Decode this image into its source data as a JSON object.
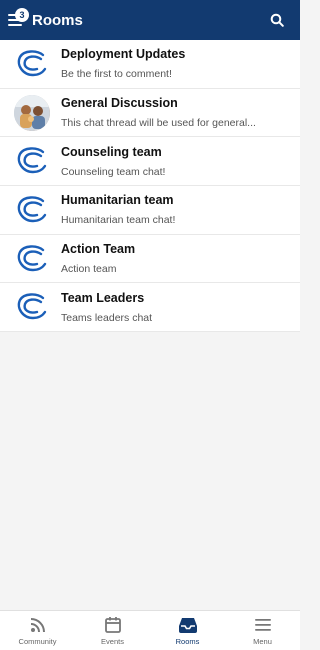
{
  "header": {
    "title": "Rooms",
    "badge_count": "3"
  },
  "rooms": [
    {
      "title": "Deployment Updates",
      "subtitle": "Be the first to comment!",
      "avatar": "logo"
    },
    {
      "title": "General Discussion",
      "subtitle": "This chat thread will be used for general...",
      "avatar": "photo"
    },
    {
      "title": "Counseling team",
      "subtitle": "Counseling team chat!",
      "avatar": "logo"
    },
    {
      "title": "Humanitarian team",
      "subtitle": "Humanitarian team chat!",
      "avatar": "logo"
    },
    {
      "title": "Action Team",
      "subtitle": "Action team",
      "avatar": "logo"
    },
    {
      "title": "Team Leaders",
      "subtitle": "Teams leaders chat",
      "avatar": "logo"
    }
  ],
  "nav": {
    "items": [
      {
        "label": "Community",
        "icon": "rss-icon",
        "active": false
      },
      {
        "label": "Events",
        "icon": "calendar-icon",
        "active": false
      },
      {
        "label": "Rooms",
        "icon": "inbox-icon",
        "active": true
      },
      {
        "label": "Menu",
        "icon": "hamburger-menu-icon",
        "active": false
      }
    ]
  },
  "colors": {
    "header_bg": "#123a70",
    "logo_blue": "#1b5fb8",
    "active_nav": "#123a70"
  }
}
